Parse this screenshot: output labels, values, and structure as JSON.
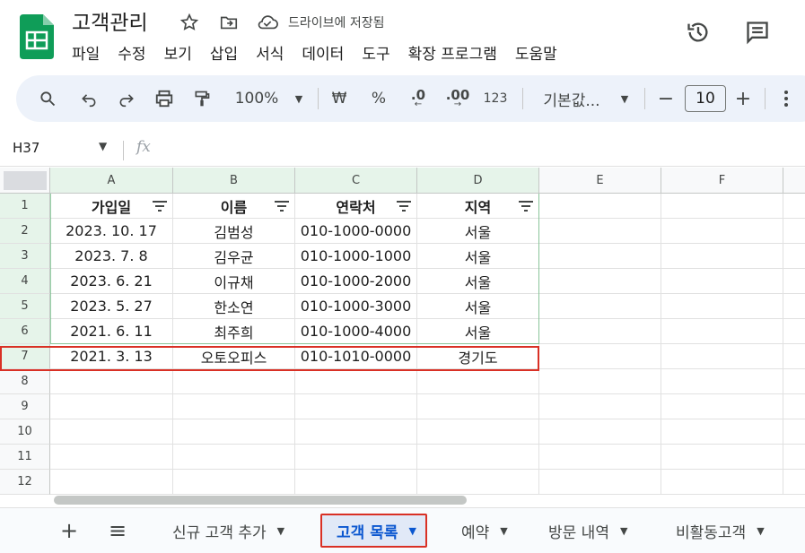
{
  "app": {
    "doc_title": "고객관리",
    "save_status": "드라이브에 저장됨",
    "brand_color": "#0f9d58"
  },
  "menu": [
    "파일",
    "수정",
    "보기",
    "삽입",
    "서식",
    "데이터",
    "도구",
    "확장 프로그램",
    "도움말"
  ],
  "toolbar": {
    "zoom": "100%",
    "currency": "₩",
    "percent": "%",
    "dec_decrease": ".0",
    "dec_increase": ".00",
    "number_format": "123",
    "font": "기본값...",
    "font_size": "10",
    "minus": "−",
    "plus": "+"
  },
  "formula_bar": {
    "cell_ref": "H37",
    "fx": "fx"
  },
  "grid": {
    "columns": [
      "A",
      "B",
      "C",
      "D",
      "E",
      "F"
    ],
    "rows": [
      "1",
      "2",
      "3",
      "4",
      "5",
      "6",
      "7",
      "8",
      "9",
      "10",
      "11",
      "12"
    ],
    "headers": [
      "가입일",
      "이름",
      "연락처",
      "지역"
    ],
    "data": [
      [
        "2023. 10. 17",
        "김범성",
        "010-1000-0000",
        "서울"
      ],
      [
        "2023. 7. 8",
        "김우균",
        "010-1000-1000",
        "서울"
      ],
      [
        "2023. 6. 21",
        "이규채",
        "010-1000-2000",
        "서울"
      ],
      [
        "2023. 5. 27",
        "한소연",
        "010-1000-3000",
        "서울"
      ],
      [
        "2021. 6. 11",
        "최주희",
        "010-1000-4000",
        "서울"
      ],
      [
        "2021. 3. 13",
        "오토오피스",
        "010-1010-0000",
        "경기도"
      ]
    ]
  },
  "sheets": {
    "add": "+",
    "all": "≡",
    "tabs": [
      "신규 고객 추가",
      "고객 목록",
      "예약",
      "방문 내역",
      "비활동고객"
    ],
    "active_index": 1
  },
  "colors": {
    "highlight": "#d93025",
    "active_tab_text": "#0b57d0",
    "active_tab_bg": "#e1e9f7"
  }
}
